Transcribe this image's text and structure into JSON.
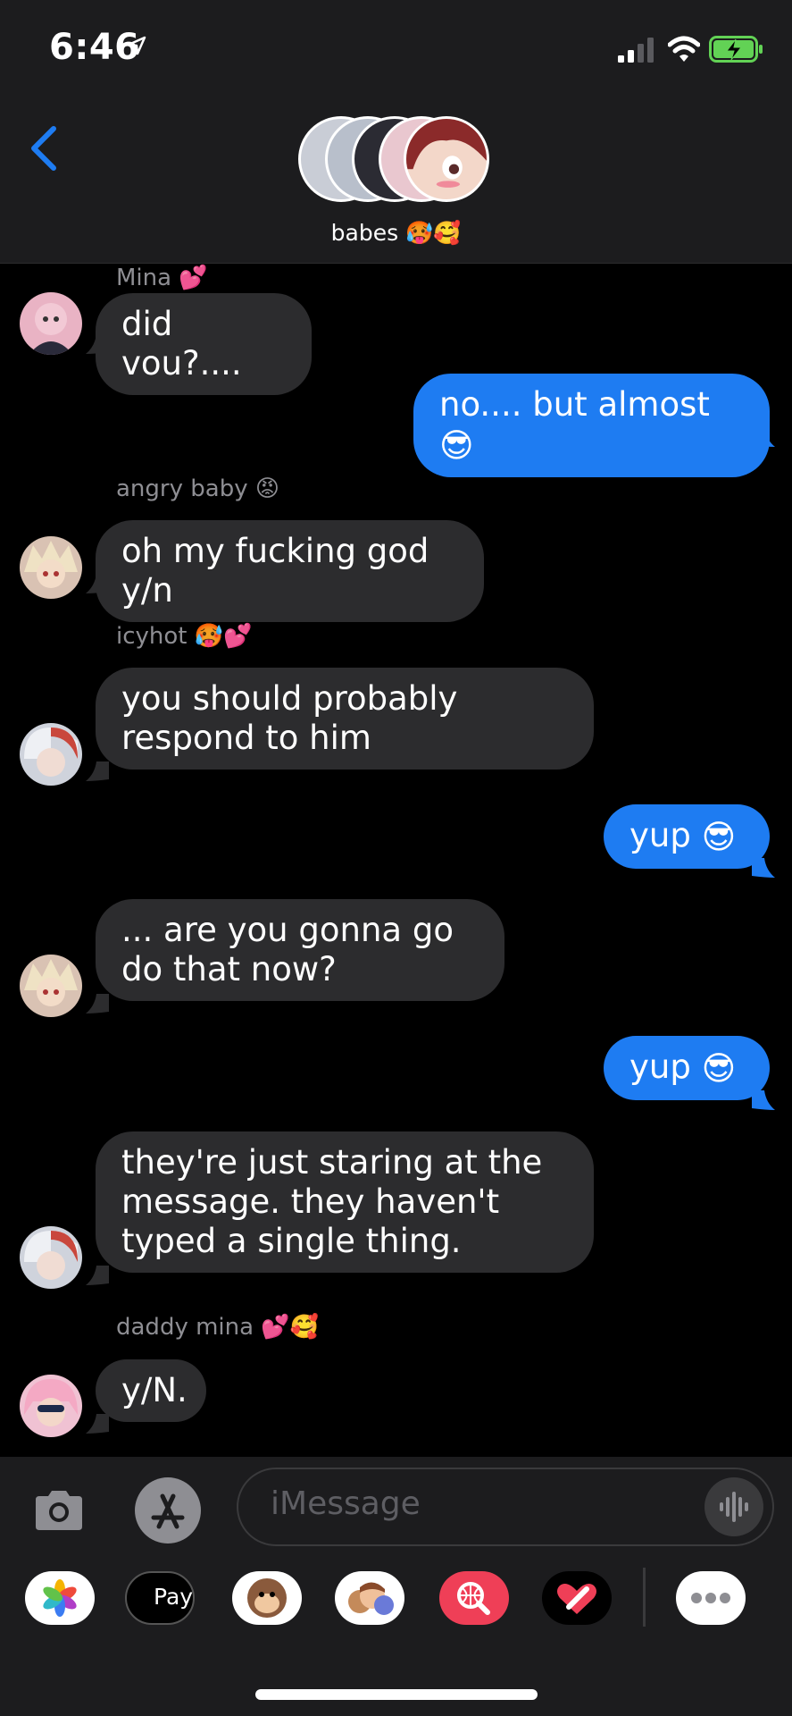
{
  "status": {
    "time": "6:46"
  },
  "header": {
    "group_name": "babes",
    "group_emoji": "🥵🥰"
  },
  "messages": [
    {
      "sender": "Mina",
      "sender_emoji": "💕",
      "text": "did vou?...."
    },
    {
      "text": "no.... but almost",
      "emoji": "😎"
    },
    {
      "sender": "angry baby",
      "sender_emoji": "😡",
      "text": "oh my fucking god y/n"
    },
    {
      "sender": "icyhot",
      "sender_emoji": "🥵💕",
      "text": "you should probably respond to him"
    },
    {
      "text": "yup",
      "emoji": "😎"
    },
    {
      "text": "... are you gonna go do that now?"
    },
    {
      "text": "yup",
      "emoji": "😎"
    },
    {
      "text": "they're just staring at the message. they haven't typed a single thing."
    },
    {
      "sender": "daddy mina",
      "sender_emoji": "💕🥰",
      "text": "y/N."
    }
  ],
  "composer": {
    "placeholder": "iMessage",
    "apple_pay": "Pay"
  },
  "colors": {
    "outgoing": "#1e7cf2",
    "incoming": "#2c2c2e",
    "back": "#1e7cf2"
  }
}
